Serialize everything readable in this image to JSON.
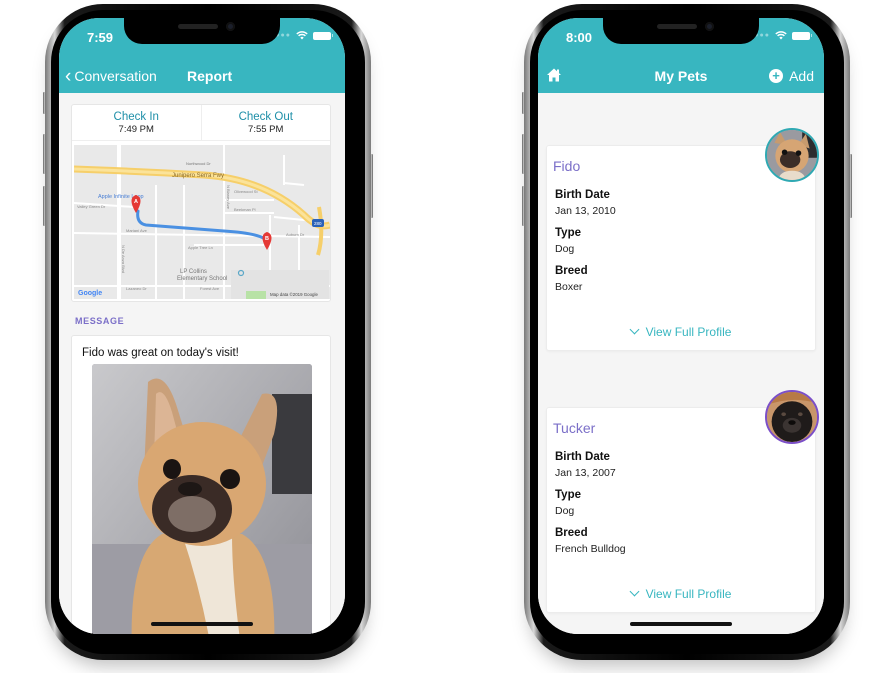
{
  "left_phone": {
    "status_bar": {
      "time": "7:59"
    },
    "nav": {
      "back_label": "Conversation",
      "title": "Report"
    },
    "check": {
      "in_label": "Check In",
      "in_time": "7:49 PM",
      "out_label": "Check Out",
      "out_time": "7:55 PM"
    },
    "map": {
      "labels": {
        "freeway": "Junipero Serra Fwy",
        "northwood": "Northwood Dr",
        "apple_loop": "Apple Infinite Loop",
        "valley_green": "Valley Green Dr",
        "olivewood": "Olivewood St",
        "beekman": "Beekman Pl",
        "mariani": "Mariani Ave",
        "auburn": "Auburn Dr",
        "apple_tree": "Apple Tree Ln",
        "de_anza": "N De Anza Blvd",
        "blaney": "N Blaney Ave",
        "lp_collins": "LP Collins",
        "elementary": "Elementary School",
        "lazaneo": "Lazaneo Dr",
        "forest": "Forest Ave",
        "google": "Google",
        "attribution": "Map data ©2019 Google",
        "marker_a": "A",
        "marker_b": "B",
        "interstate": "280"
      }
    },
    "message": {
      "section_label": "MESSAGE",
      "text": "Fido was great on today's visit!"
    }
  },
  "right_phone": {
    "status_bar": {
      "time": "8:00"
    },
    "nav": {
      "title": "My Pets",
      "add_label": "Add"
    },
    "pets": [
      {
        "name": "Fido",
        "fields": [
          {
            "label": "Birth Date",
            "value": "Jan 13, 2010"
          },
          {
            "label": "Type",
            "value": "Dog"
          },
          {
            "label": "Breed",
            "value": "Boxer"
          }
        ],
        "action": "View Full Profile",
        "avatar_border": "#2fa9b3"
      },
      {
        "name": "Tucker",
        "fields": [
          {
            "label": "Birth Date",
            "value": "Jan 13, 2007"
          },
          {
            "label": "Type",
            "value": "Dog"
          },
          {
            "label": "Breed",
            "value": "French Bulldog"
          }
        ],
        "action": "View Full Profile",
        "avatar_border": "#7b4fc8"
      }
    ]
  },
  "colors": {
    "header_teal": "#38b6c0",
    "accent_purple": "#7b6fc8",
    "link_teal": "#1e8fa8",
    "route_blue": "#4a90e2",
    "marker_red": "#e53935"
  }
}
